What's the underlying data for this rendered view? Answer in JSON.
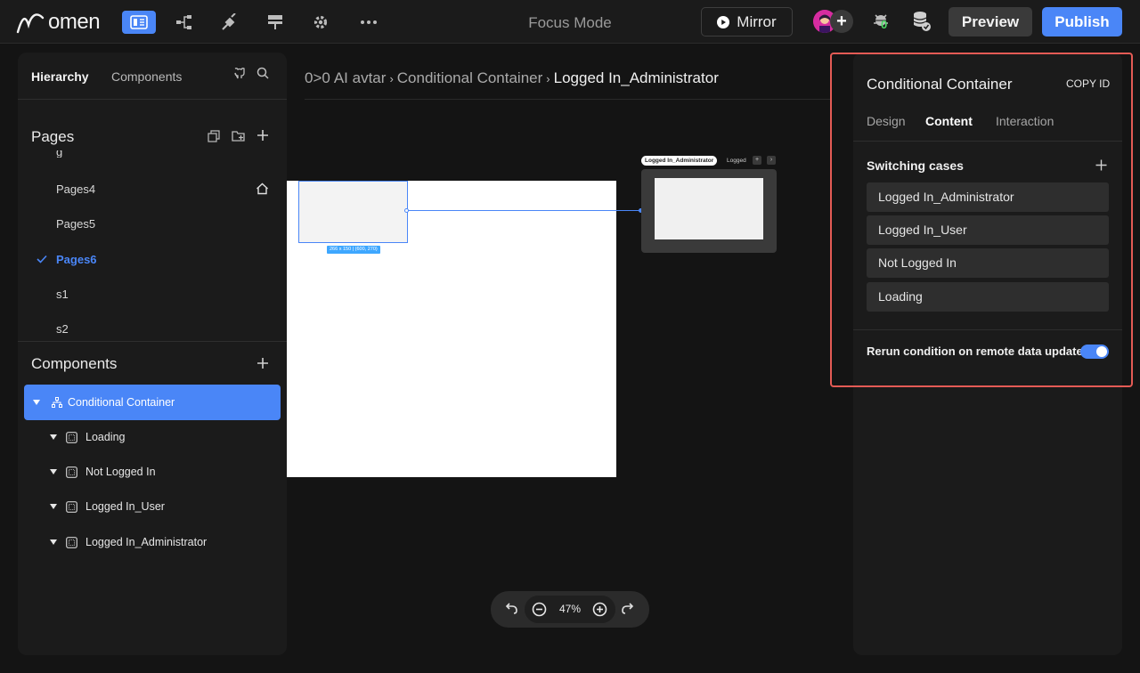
{
  "app": {
    "logo_text": "omen"
  },
  "topbar": {
    "focus_mode": "Focus Mode",
    "mirror_label": "Mirror",
    "preview_label": "Preview",
    "publish_label": "Publish",
    "badge_count": "0"
  },
  "left_panel": {
    "tabs": {
      "hierarchy": "Hierarchy",
      "components": "Components"
    },
    "pages_title": "Pages",
    "pages": [
      {
        "label": "Pages4"
      },
      {
        "label": "Pages5"
      },
      {
        "label": "Pages6"
      },
      {
        "label": "s1"
      },
      {
        "label": "s2"
      }
    ],
    "components_title": "Components",
    "tree": [
      {
        "label": "Conditional Container"
      },
      {
        "label": "Loading"
      },
      {
        "label": "Not Logged In"
      },
      {
        "label": "Logged In_User"
      },
      {
        "label": "Logged In_Administrator"
      }
    ]
  },
  "canvas": {
    "breadcrumb": {
      "prefix": "0>0",
      "items": [
        "AI avtar",
        "Conditional Container",
        "Logged In_Administrator"
      ]
    },
    "selection_dim": "266 x 150 | (600, 270)",
    "case_tag": "Logged In_Administrator",
    "case_tag2": "Logged",
    "zoom": "47%"
  },
  "right_panel": {
    "title": "Conditional Container",
    "copy_id": "COPY ID",
    "tabs": {
      "design": "Design",
      "content": "Content",
      "interaction": "Interaction"
    },
    "switching_cases_title": "Switching cases",
    "cases": [
      {
        "label": "Logged In_Administrator"
      },
      {
        "label": "Logged In_User"
      },
      {
        "label": "Not Logged In"
      },
      {
        "label": "Loading"
      }
    ],
    "rerun_label": "Rerun condition on remote data update"
  },
  "colors": {
    "accent": "#4a86f7",
    "highlight": "#e45b55",
    "panel": "#1b1b1b"
  }
}
